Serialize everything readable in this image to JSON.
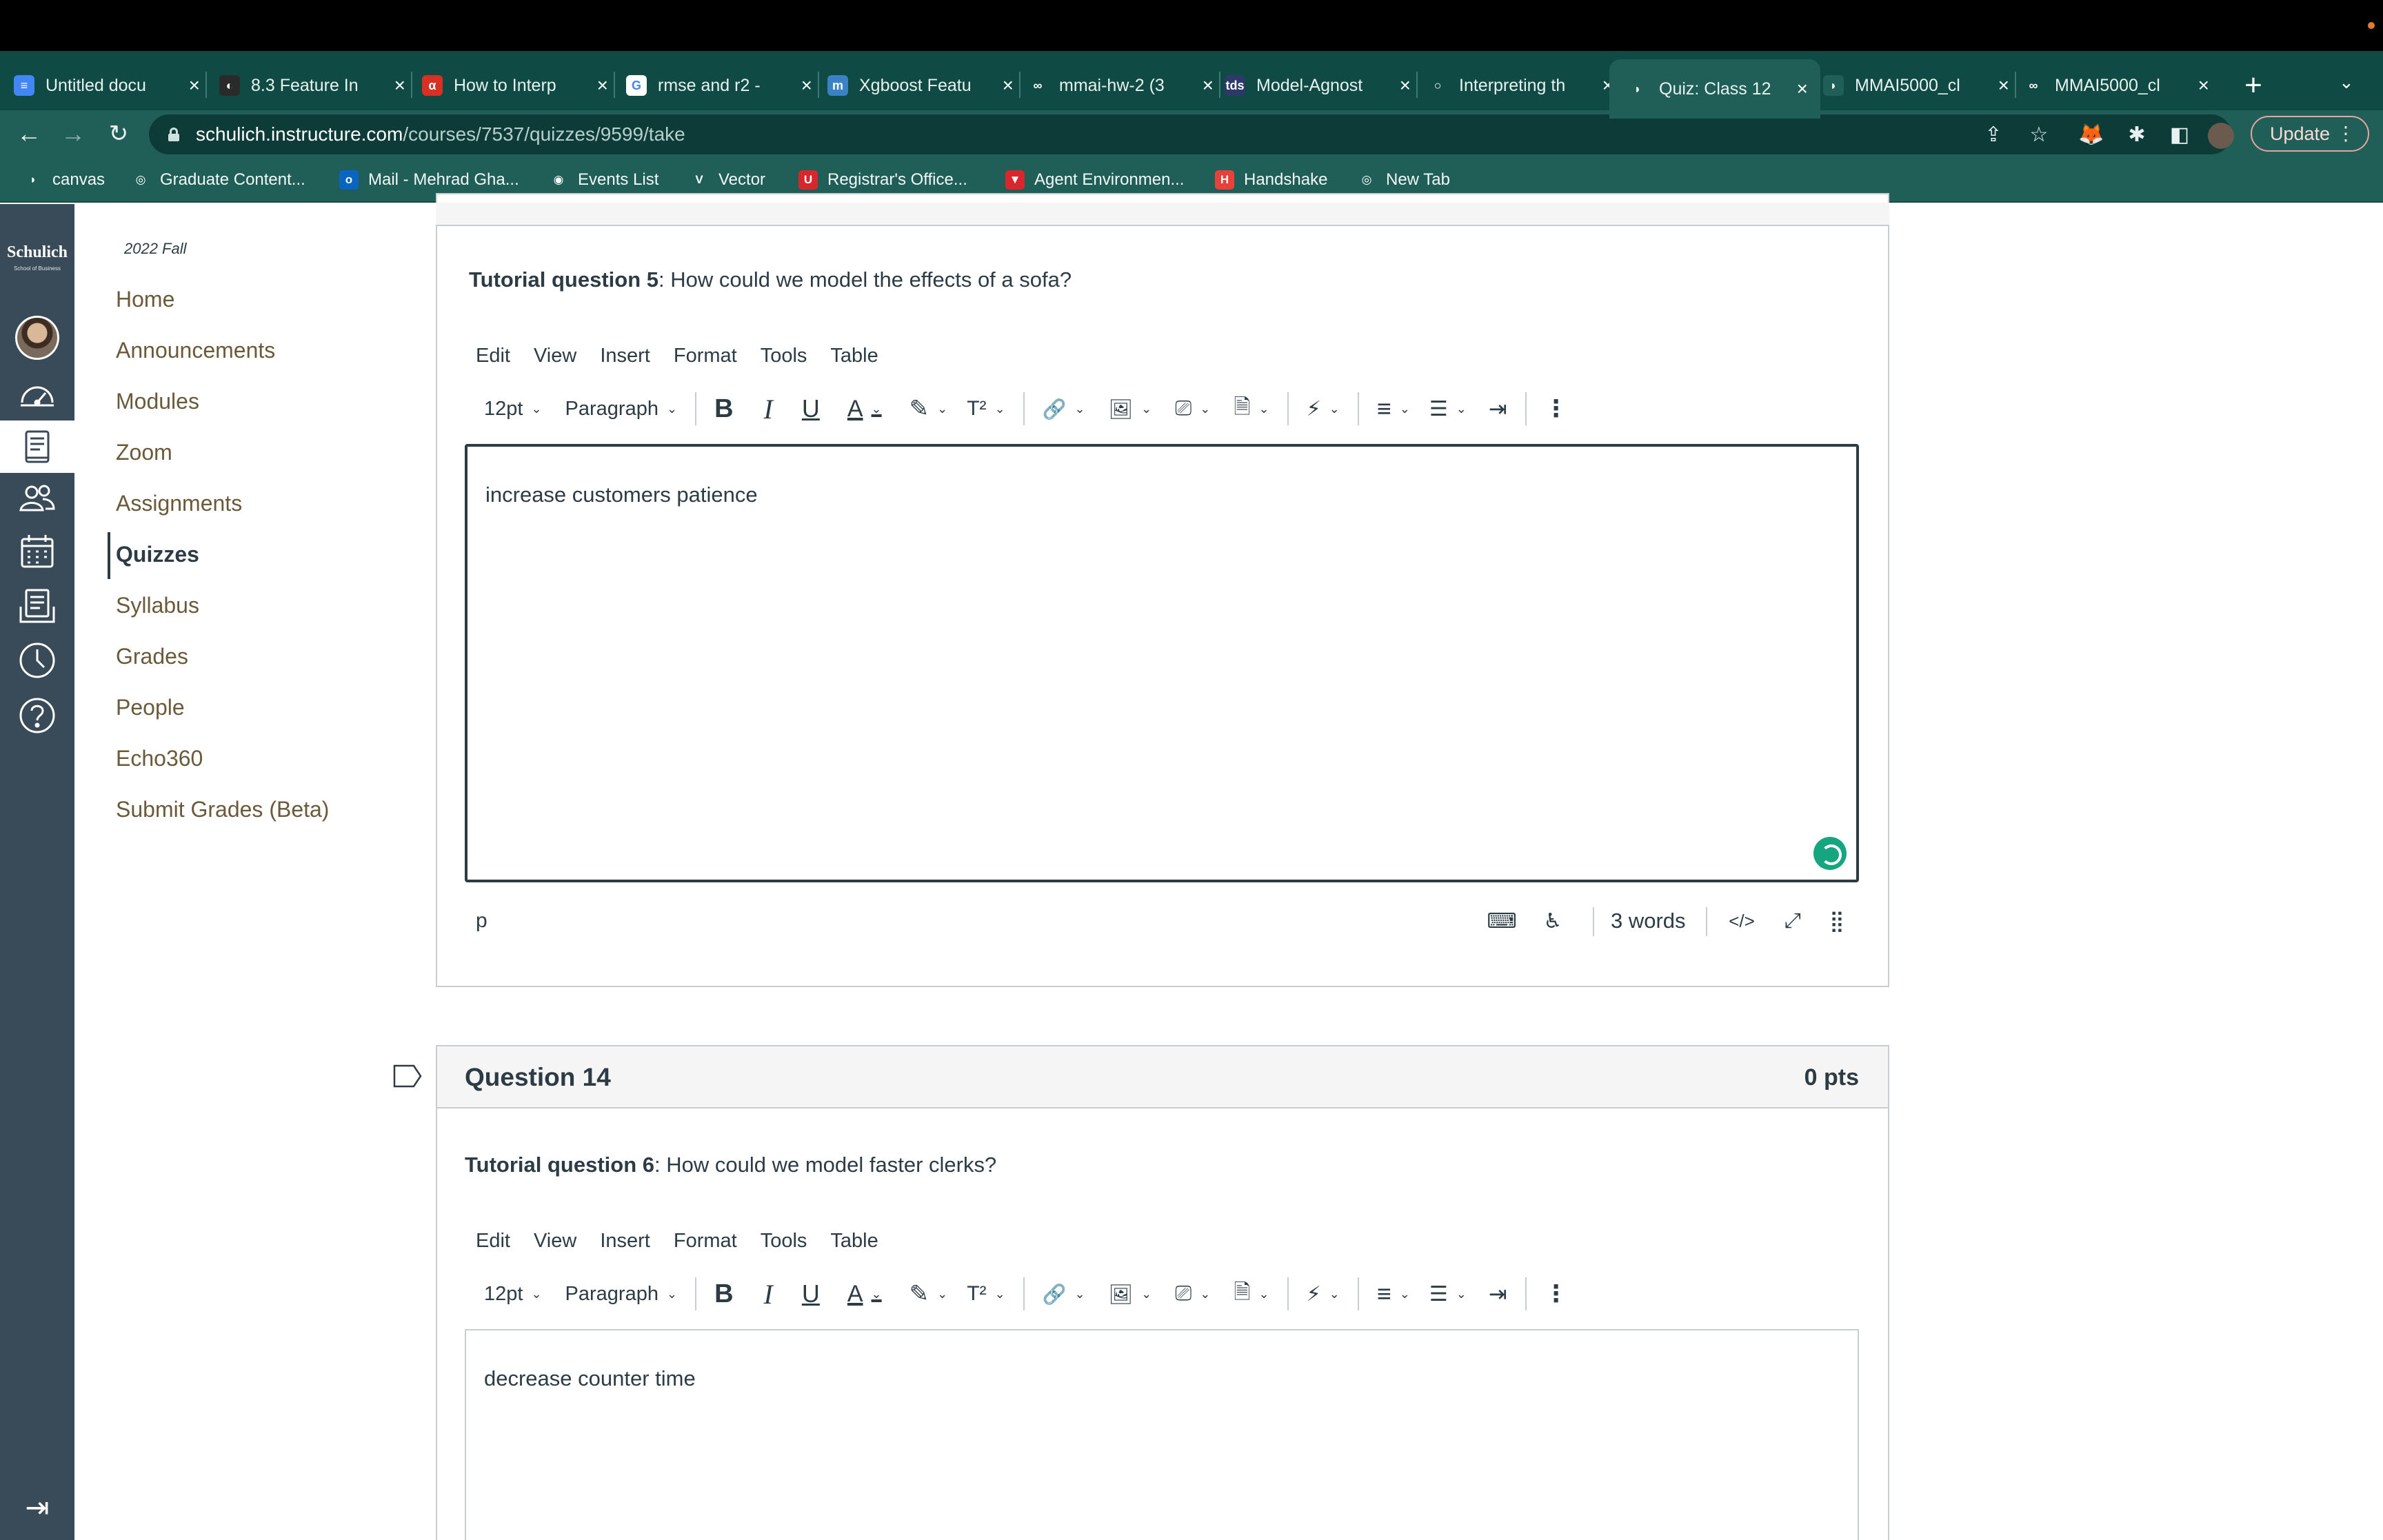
{
  "browser": {
    "tabs": [
      {
        "label": "Untitled docu",
        "favicon_color": "#4285f4",
        "favicon": "≡"
      },
      {
        "label": "8.3 Feature In",
        "favicon_color": "#2a2a2a",
        "favicon": "◐"
      },
      {
        "label": "How to Interp",
        "favicon_color": "#d93025",
        "favicon": "α"
      },
      {
        "label": "rmse and r2 -",
        "favicon_color": "#ffffff",
        "favicon": "G"
      },
      {
        "label": "Xgboost Featu",
        "favicon_color": "#3b82c4",
        "favicon": "m"
      },
      {
        "label": "mmai-hw-2 (3",
        "favicon_color": "#0f4a45",
        "favicon": "∞"
      },
      {
        "label": "Model-Agnost",
        "favicon_color": "#2b3a67",
        "favicon": "tds"
      },
      {
        "label": "Interpreting th",
        "favicon_color": "#0f4a45",
        "favicon": "○"
      },
      {
        "label": "Quiz: Class 12",
        "favicon_color": "#1f5f58",
        "favicon": "◗"
      },
      {
        "label": "MMAI5000_cl",
        "favicon_color": "#1f5f58",
        "favicon": "◗"
      },
      {
        "label": "MMAI5000_cl",
        "favicon_color": "#0f4a45",
        "favicon": "∞"
      }
    ],
    "active_tab_index": 8,
    "url_host": "schulich.instructure.com",
    "url_path": "/courses/7537/quizzes/9599/take",
    "update_label": "Update",
    "bookmarks": [
      {
        "label": "canvas",
        "icon": "◗",
        "color": "#1f5f58"
      },
      {
        "label": "Graduate Content...",
        "icon": "◎",
        "color": "#1f5f58"
      },
      {
        "label": "Mail - Mehrad Gha...",
        "icon": "o",
        "color": "#0a64c2"
      },
      {
        "label": "Events List",
        "icon": "◉",
        "color": "#1f5f58"
      },
      {
        "label": "Vector",
        "icon": "V",
        "color": "#1f5f58"
      },
      {
        "label": "Registrar's Office...",
        "icon": "U",
        "color": "#d9262c"
      },
      {
        "label": "Agent Environmen...",
        "icon": "▼",
        "color": "#d9262c"
      },
      {
        "label": "Handshake",
        "icon": "H",
        "color": "#e8413b"
      },
      {
        "label": "New Tab",
        "icon": "◎",
        "color": "#1f5f58"
      }
    ]
  },
  "global_nav": {
    "logo": "Schulich",
    "logo_sub": "School of Business",
    "items": [
      "account-avatar",
      "dashboard-icon",
      "courses-icon",
      "groups-icon",
      "calendar-icon",
      "inbox-icon",
      "history-icon",
      "help-icon"
    ]
  },
  "course_nav": {
    "term": "2022 Fall",
    "items": [
      "Home",
      "Announcements",
      "Modules",
      "Zoom",
      "Assignments",
      "Quizzes",
      "Syllabus",
      "Grades",
      "People",
      "Echo360",
      "Submit Grades (Beta)"
    ],
    "active_index": 5
  },
  "questions": [
    {
      "prompt_bold": "Tutorial question 5",
      "prompt_rest": ": How could we model the effects of a sofa?",
      "answer": "increase customers patience",
      "path": "p",
      "word_count": "3 words"
    },
    {
      "title": "Question 14",
      "points": "0 pts",
      "prompt_bold": "Tutorial question 6",
      "prompt_rest": ": How could we model faster clerks?",
      "answer": "decrease counter time"
    }
  ],
  "editor": {
    "menu": [
      "Edit",
      "View",
      "Insert",
      "Format",
      "Tools",
      "Table"
    ],
    "font_size": "12pt",
    "block_format": "Paragraph",
    "html_toggle": "</>"
  }
}
